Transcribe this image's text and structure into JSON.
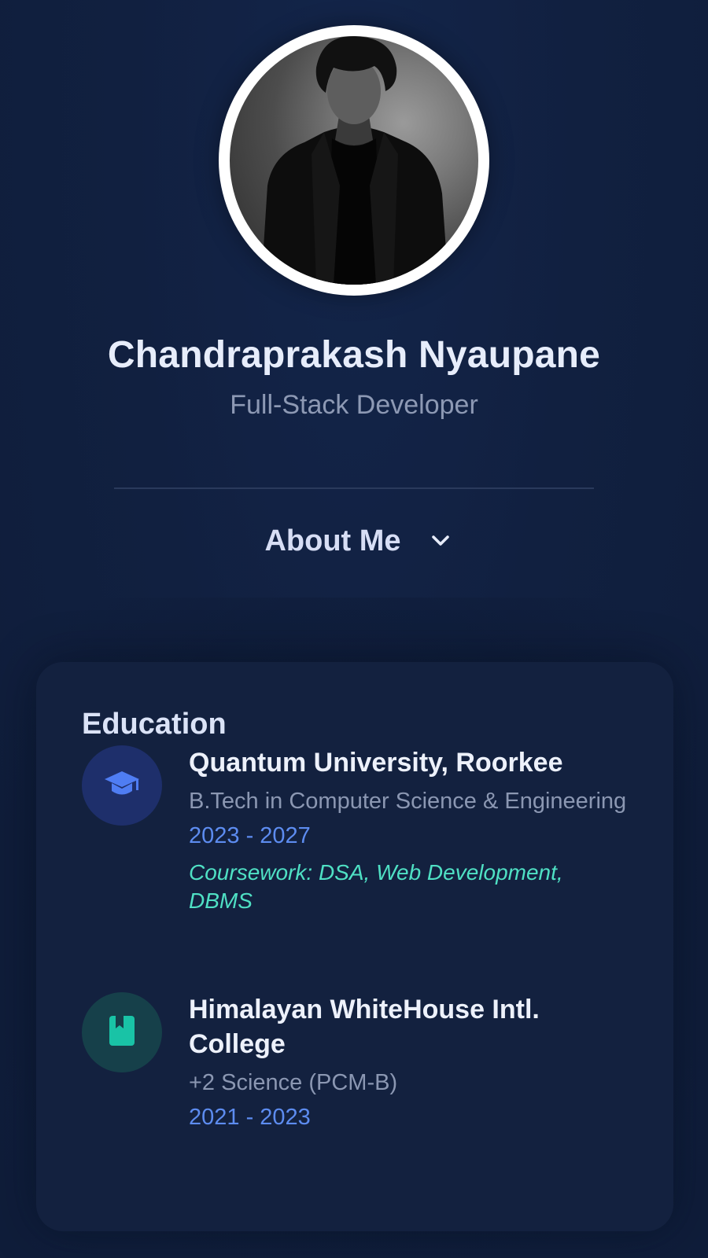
{
  "profile": {
    "name": "Chandraprakash Nyaupane",
    "role": "Full-Stack Developer",
    "avatar_icon": "profile-photo"
  },
  "about": {
    "label": "About Me",
    "toggle_icon": "chevron-down-icon"
  },
  "education": {
    "title": "Education",
    "items": [
      {
        "icon": "graduation-cap-icon",
        "icon_color": "#4f7df3",
        "school": "Quantum University, Roorkee",
        "degree": "B.Tech in Computer Science & Engineering",
        "years": "2023 - 2027",
        "coursework": "Coursework: DSA, Web Development, DBMS"
      },
      {
        "icon": "book-icon",
        "icon_color": "#19c3a6",
        "school": "Himalayan WhiteHouse Intl. College",
        "degree": "+2 Science (PCM-B)",
        "years": "2021 - 2023"
      }
    ]
  },
  "colors": {
    "background": "#11203e",
    "card": "#13213f",
    "accent_blue": "#5d8cf0",
    "accent_teal": "#4fe0c4"
  }
}
